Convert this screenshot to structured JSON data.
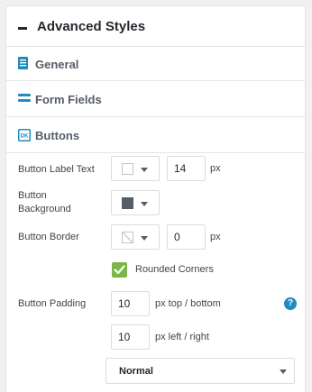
{
  "panel": {
    "title": "Advanced Styles",
    "collapse_icon": "minus-icon"
  },
  "sections": {
    "general": {
      "label": "General",
      "icon": "document-icon",
      "color": "#1e8cbe"
    },
    "form_fields": {
      "label": "Form Fields",
      "icon": "field-bars-icon",
      "color": "#1e8cbe"
    },
    "buttons": {
      "label": "Buttons",
      "icon": "button-icon",
      "icon_text": "DK",
      "color": "#1e8cbe"
    }
  },
  "fields": {
    "label_text": {
      "label": "Button Label Text",
      "font_size": "14",
      "unit": "px",
      "color": "#ffffff"
    },
    "background": {
      "label_line1": "Button",
      "label_line2": "Background",
      "color": "#555d66"
    },
    "border": {
      "label": "Button Border",
      "width": "0",
      "unit": "px",
      "color": "none"
    },
    "rounded": {
      "label": "Rounded Corners",
      "checked": true
    },
    "padding": {
      "label": "Button Padding",
      "top_bottom": "10",
      "top_bottom_unit": "px top / bottom",
      "left_right": "10",
      "left_right_unit": "px left / right",
      "help_icon": "help-icon",
      "help_glyph": "?"
    },
    "weight": {
      "selected": "Normal"
    }
  }
}
